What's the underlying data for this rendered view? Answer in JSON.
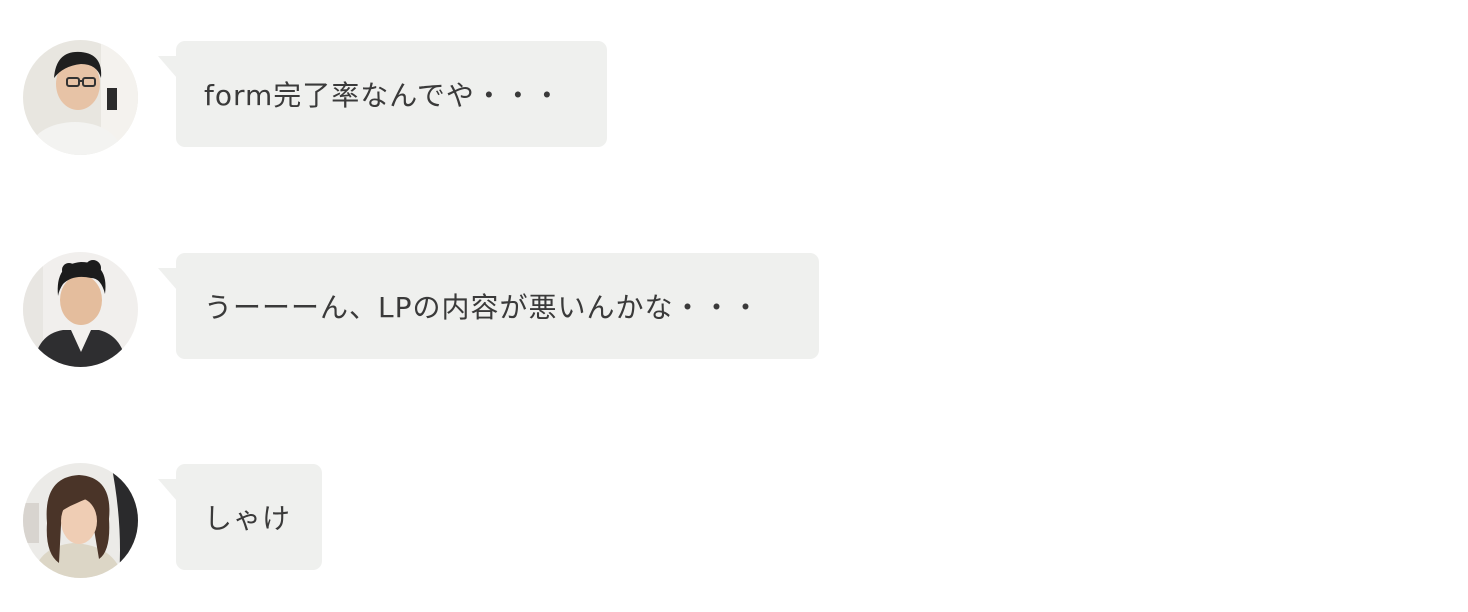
{
  "messages": [
    {
      "avatar_icon": "person-glasses-avatar",
      "text": "form完了率なんでや・・・"
    },
    {
      "avatar_icon": "person-short-hair-avatar",
      "text": "うーーーん、LPの内容が悪いんかな・・・"
    },
    {
      "avatar_icon": "person-long-hair-avatar",
      "text": "しゃけ"
    }
  ],
  "colors": {
    "bubble_background": "#eff0ee",
    "text": "#3a3a3a",
    "page_background": "#ffffff"
  }
}
